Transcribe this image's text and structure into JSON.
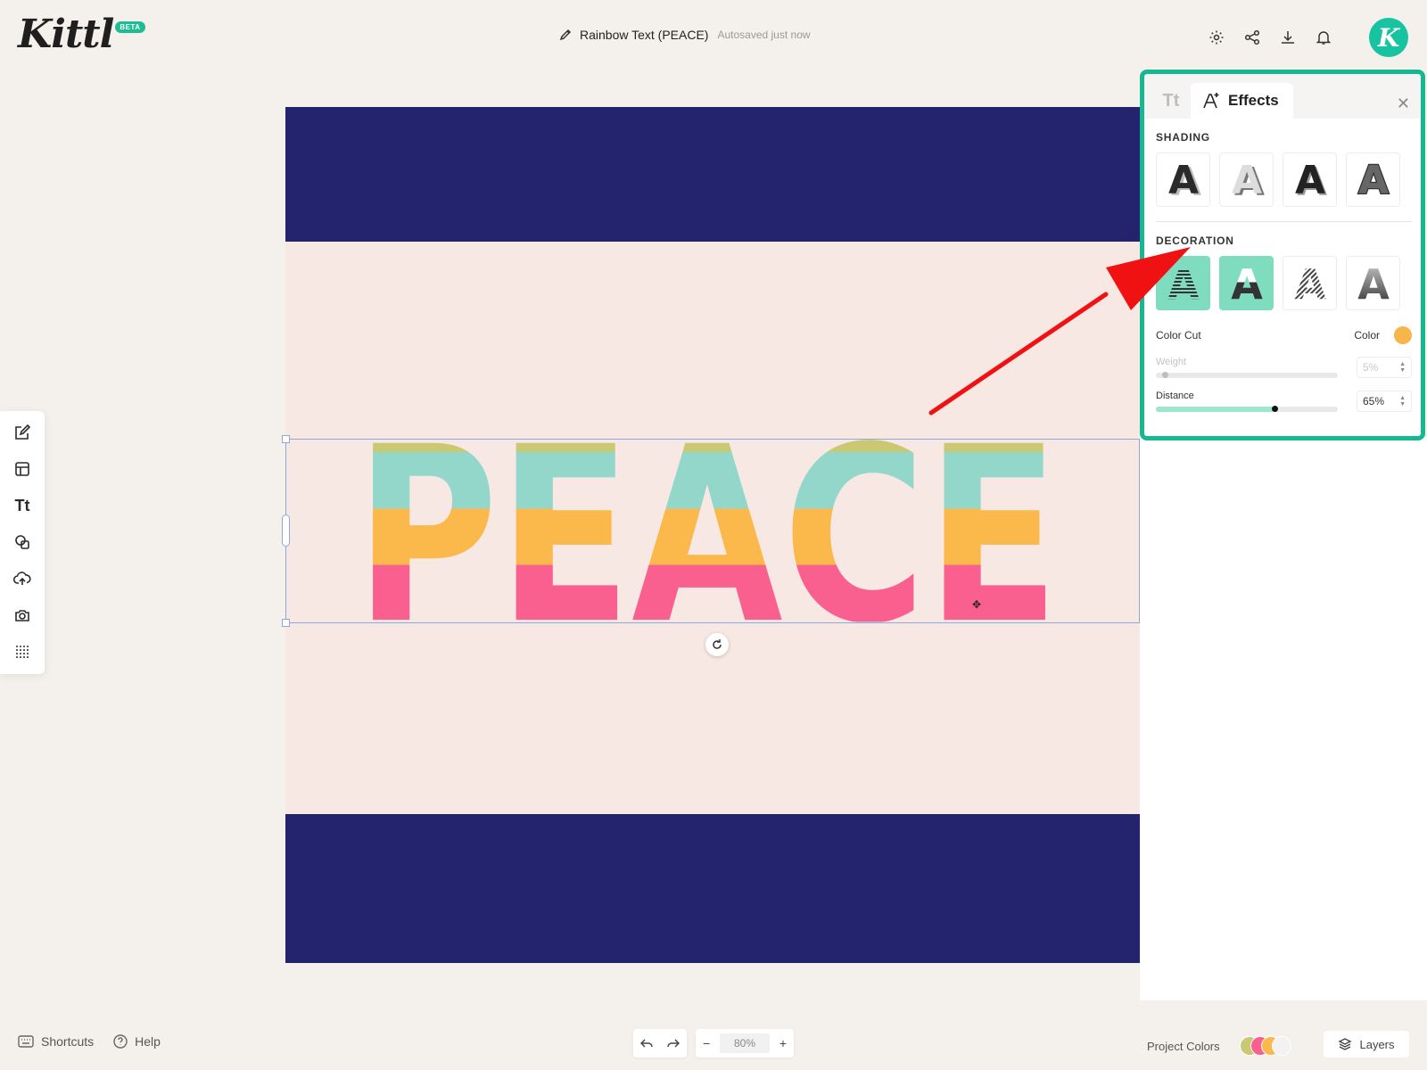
{
  "header": {
    "logo": "Kittl",
    "beta_badge": "BETA",
    "document_name": "Rainbow Text (PEACE)",
    "autosave_status": "Autosaved just now",
    "avatar_letter": "K",
    "actions": [
      "gear-icon",
      "share-icon",
      "download-icon",
      "bell-icon"
    ]
  },
  "left_toolbar": {
    "tools": [
      "edit-icon",
      "templates-icon",
      "text-tool",
      "elements-icon",
      "upload-icon",
      "camera-icon",
      "grid-dots-icon"
    ],
    "text_tool_label": "Tt"
  },
  "canvas": {
    "text": "PEACE",
    "background": "#f8e8e4",
    "band_color": "#24246e",
    "stripe_colors": [
      "#cbc874",
      "#93d7cb",
      "#fbb84b",
      "#f9608f",
      "#cfb3d8"
    ]
  },
  "effects_panel": {
    "text_tab_label": "Tt",
    "active_tab": "Effects",
    "shading_title": "SHADING",
    "decoration_title": "DECORATION",
    "selected_decoration": 2,
    "color_cut_label": "Color Cut",
    "color_label": "Color",
    "color_value": "#f7b54a",
    "weight": {
      "label": "Weight",
      "value": "5%",
      "level": 0.05
    },
    "distance": {
      "label": "Distance",
      "value": "65%",
      "level": 0.65
    }
  },
  "bottom": {
    "shortcuts": "Shortcuts",
    "help": "Help",
    "zoom": "80%",
    "project_colors": "Project Colors",
    "project_color_swatches": [
      "#cbc874",
      "#f9608f",
      "#fbb84b",
      "#f2f2f2"
    ],
    "layers": "Layers"
  },
  "accent": "#15b890"
}
